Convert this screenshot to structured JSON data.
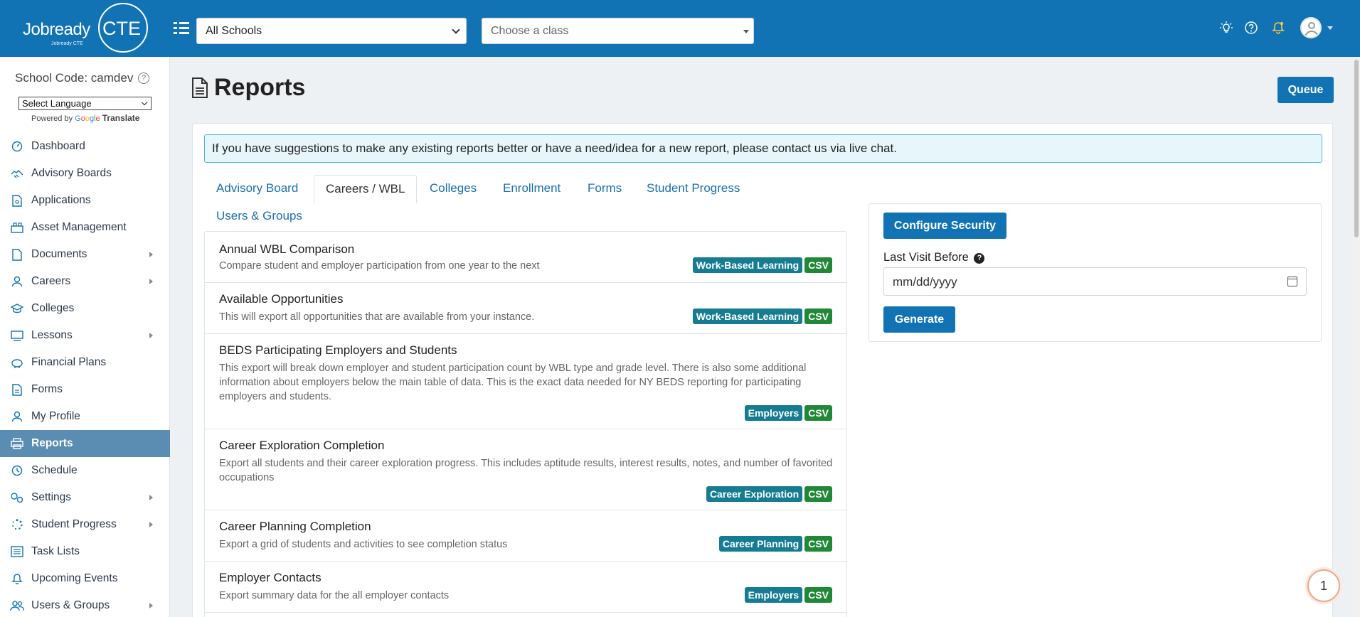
{
  "header": {
    "logo_word": "Jobready",
    "logo_cte": "CTE",
    "logo_sub": "Jobready CTE",
    "school_select": "All Schools",
    "class_select_placeholder": "Choose a class",
    "icons": [
      "lightbulb-icon",
      "help-icon",
      "bell-icon",
      "user-avatar"
    ]
  },
  "sidebar": {
    "school_code": "School Code: camdev",
    "language_select": "Select Language",
    "powered_by": "Powered by",
    "google": [
      "G",
      "o",
      "o",
      "g",
      "l",
      "e"
    ],
    "translate": "Translate",
    "items": [
      {
        "label": "Dashboard",
        "icon": "gauge-icon",
        "submenu": false
      },
      {
        "label": "Advisory Boards",
        "icon": "handshake-icon",
        "submenu": false
      },
      {
        "label": "Applications",
        "icon": "file-icon",
        "submenu": false
      },
      {
        "label": "Asset Management",
        "icon": "assets-icon",
        "submenu": false
      },
      {
        "label": "Documents",
        "icon": "document-icon",
        "submenu": true
      },
      {
        "label": "Careers",
        "icon": "person-icon",
        "submenu": true
      },
      {
        "label": "Colleges",
        "icon": "graduation-cap-icon",
        "submenu": false
      },
      {
        "label": "Lessons",
        "icon": "lessons-icon",
        "submenu": true
      },
      {
        "label": "Financial Plans",
        "icon": "piggy-bank-icon",
        "submenu": false
      },
      {
        "label": "Forms",
        "icon": "form-icon",
        "submenu": false
      },
      {
        "label": "My Profile",
        "icon": "user-icon",
        "submenu": false
      },
      {
        "label": "Reports",
        "icon": "printer-icon",
        "submenu": false,
        "active": true
      },
      {
        "label": "Schedule",
        "icon": "clock-icon",
        "submenu": false
      },
      {
        "label": "Settings",
        "icon": "gears-icon",
        "submenu": true
      },
      {
        "label": "Student Progress",
        "icon": "spinner-icon",
        "submenu": true
      },
      {
        "label": "Task Lists",
        "icon": "list-icon",
        "submenu": false
      },
      {
        "label": "Upcoming Events",
        "icon": "bell-icon",
        "submenu": false
      },
      {
        "label": "Users & Groups",
        "icon": "users-icon",
        "submenu": true
      }
    ]
  },
  "main": {
    "title": "Reports",
    "queue_label": "Queue",
    "alert": "If you have suggestions to make any existing reports better or have a need/idea for a new report, please contact us via live chat.",
    "tabs": [
      "Advisory Board",
      "Careers / WBL",
      "Colleges",
      "Enrollment",
      "Forms",
      "Student Progress",
      "Users & Groups"
    ],
    "active_tab": "Careers / WBL",
    "reports": [
      {
        "title": "Annual WBL Comparison",
        "desc": "Compare student and employer participation from one year to the next",
        "category": "Work-Based Learning",
        "format": "CSV"
      },
      {
        "title": "Available Opportunities",
        "desc": "This will export all opportunities that are available from your instance.",
        "category": "Work-Based Learning",
        "format": "CSV"
      },
      {
        "title": "BEDS Participating Employers and Students",
        "desc": "This export will break down employer and student participation count by WBL type and grade level. There is also some additional information about employers below the main table of data. This is the exact data needed for NY BEDS reporting for participating employers and students.",
        "category": "Employers",
        "format": "CSV"
      },
      {
        "title": "Career Exploration Completion",
        "desc": "Export all students and their career exploration progress. This includes aptitude results, interest results, notes, and number of favorited occupations",
        "category": "Career Exploration",
        "format": "CSV"
      },
      {
        "title": "Career Planning Completion",
        "desc": "Export a grid of students and activities to see completion status",
        "category": "Career Planning",
        "format": "CSV"
      },
      {
        "title": "Employer Contacts",
        "desc": "Export summary data for the all employer contacts",
        "category": "Employers",
        "format": "CSV"
      }
    ],
    "config_security_label": "Configure Security",
    "last_visit_label": "Last Visit Before",
    "date_placeholder": "mm/dd/yyyy",
    "generate_label": "Generate"
  },
  "chat_bubble": "1",
  "colors": {
    "brand": "#1273b4",
    "active_nav": "#5b8db2",
    "badge_category": "#157c92",
    "badge_csv": "#218838"
  }
}
